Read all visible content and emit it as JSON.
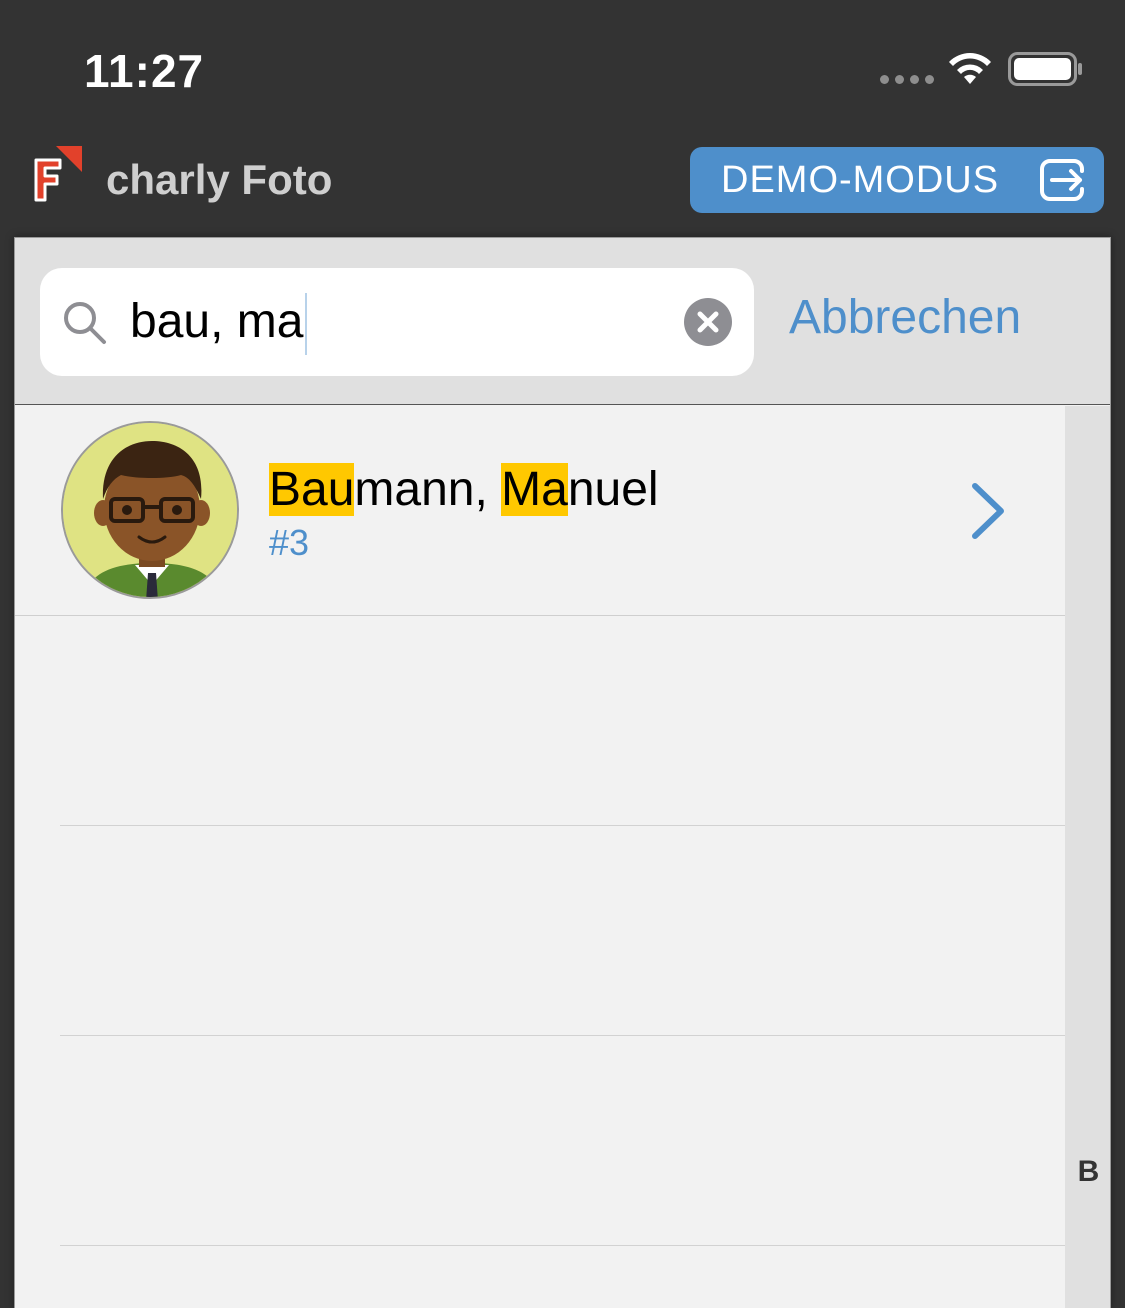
{
  "status_bar": {
    "time": "11:27",
    "icons": [
      "signal-dots-icon",
      "wifi-icon",
      "battery-icon"
    ]
  },
  "header": {
    "logo_icon": "charly-logo-icon",
    "app_title": "charly Foto",
    "demo_button_label": "DEMO-MODUS",
    "demo_button_icon": "exit-icon"
  },
  "search": {
    "value": "bau, ma",
    "clear_icon": "clear-icon",
    "cancel_label": "Abbrechen"
  },
  "results": [
    {
      "name_parts": [
        {
          "text": "Bau",
          "highlight": true
        },
        {
          "text": "mann, ",
          "highlight": false
        },
        {
          "text": "Ma",
          "highlight": true
        },
        {
          "text": "nuel",
          "highlight": false
        }
      ],
      "id": "#3",
      "avatar_icon": "avatar-man-glasses-icon"
    }
  ],
  "index": {
    "letters": [
      "B"
    ]
  },
  "colors": {
    "accent": "#4e8fcb",
    "highlight": "#ffc800",
    "header_bg": "#333333",
    "panel_bg": "#f2f2f2"
  }
}
